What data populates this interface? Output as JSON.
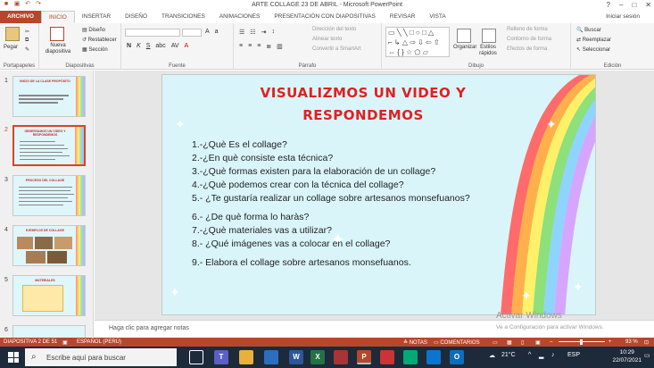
{
  "app": {
    "window_title": "ARTE COLLAGE 23 DE ABRIL  -  Microsoft PowerPoint",
    "sign_in": "Iniciar sesión"
  },
  "tabs": [
    "ARCHIVO",
    "INICIO",
    "INSERTAR",
    "DISEÑO",
    "TRANSICIONES",
    "ANIMACIONES",
    "PRESENTACIÓN CON DIAPOSITIVAS",
    "REVISAR",
    "VISTA"
  ],
  "ribbon": {
    "paste": "Pegar",
    "clipboard_group": "Portapapeles",
    "new_slide": "Nueva diapositiva",
    "layout": "Diseño",
    "reset": "Restablecer",
    "section": "Sección",
    "slides_group": "Diapositivas",
    "font_group": "Fuente",
    "text_direction": "Dirección del texto",
    "align_text": "Alinear texto",
    "convert_smartart": "Convertir a SmartArt",
    "paragraph_group": "Párrafo",
    "arrange": "Organizar",
    "quick_styles": "Estilos rápidos",
    "shape_fill": "Relleno de forma",
    "shape_outline": "Contorno de forma",
    "shape_effects": "Efectos de forma",
    "drawing_group": "Dibujo",
    "find": "Buscar",
    "replace": "Reemplazar",
    "select": "Seleccionar",
    "editing_group": "Edición"
  },
  "thumbnails": [
    {
      "num": "1",
      "title": "INICIO DE LA CLASE PROPÓSITO"
    },
    {
      "num": "2",
      "title": "OBSERVAMOS UN VIDEO Y RESPONDEMOS"
    },
    {
      "num": "3",
      "title": "PROCESO DEL COLLAGE"
    },
    {
      "num": "4",
      "title": "EJEMPLOS DE COLLAGE"
    },
    {
      "num": "5",
      "title": "MATERIALES"
    },
    {
      "num": "6",
      "title": ""
    }
  ],
  "slide": {
    "title": "VISUALIZMOS UN VIDEO Y RESPONDEMOS",
    "questions": [
      "1.-¿Què Es el collage?",
      "2.-¿En què consiste esta técnica?",
      "3.-¿Què formas existen para la elaboración de un collage?",
      "4.-¿Què podemos crear con la técnica del collage?",
      "5.- ¿Te gustaría realizar un collage sobre artesanos monsefuanos?",
      "6.- ¿De què forma lo haràs?",
      "7.-¿Què materiales vas a utilizar?",
      "8.- ¿Qué imágenes vas a colocar en el collage?",
      "9.- Elabora el collage sobre artesanos monsefuanos."
    ]
  },
  "notes_placeholder": "Haga clic para agregar notas",
  "watermark": {
    "line1": "Activar Windows",
    "line2": "Ve a Configuración para activar Windows."
  },
  "status_bar": {
    "slide_info": "DIAPOSITIVA 2 DE 51",
    "language": "ESPAÑOL (PERÚ)",
    "notes": "NOTAS",
    "comments": "COMENTARIOS",
    "zoom": "93 %"
  },
  "taskbar": {
    "search_placeholder": "Escribe aquí para buscar",
    "temperature": "21°C",
    "lang": "ESP",
    "time": "10:29",
    "date": "22/07/2021"
  },
  "colors": {
    "accent": "#b7472a",
    "title_red": "#e02020",
    "slide_bg": "#d9f5fa"
  }
}
